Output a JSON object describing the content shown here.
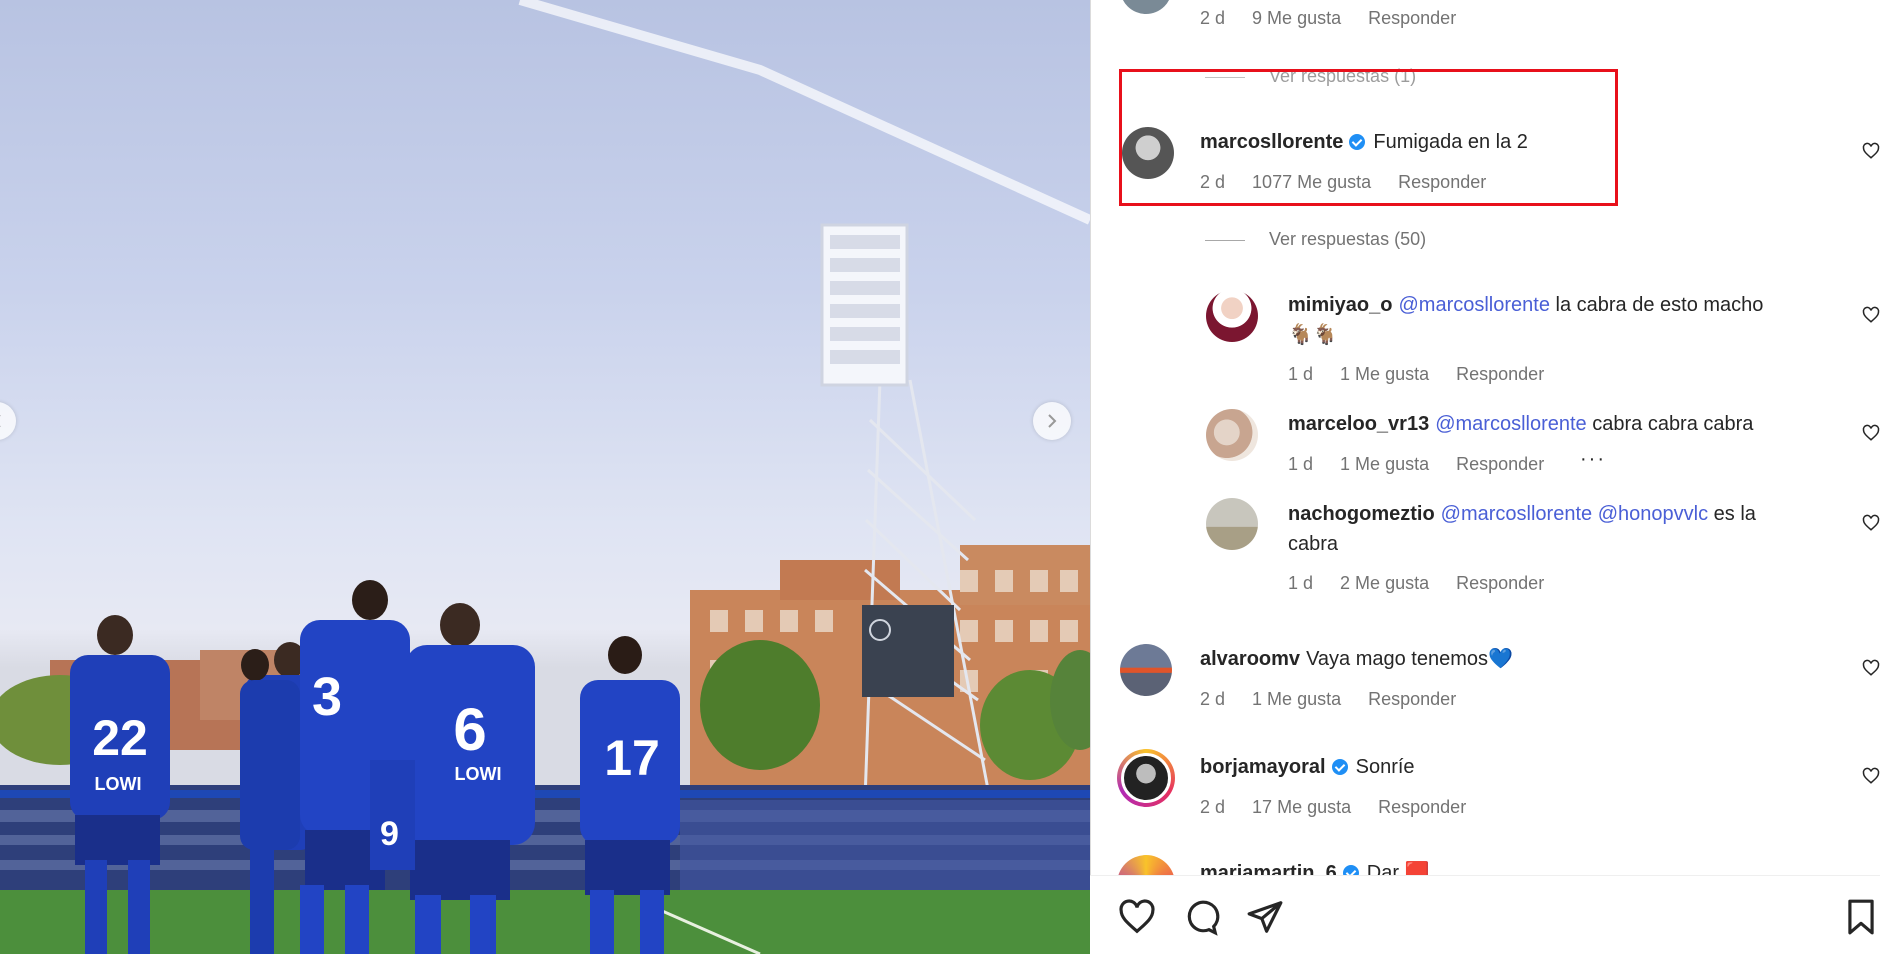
{
  "post_nav": {
    "next_icon": "chevron-right-icon",
    "prev_icon": "chevron-left-icon"
  },
  "colors": {
    "highlight": "#e8101b",
    "mention": "#4a5fd6",
    "verified": "#1f8ff5",
    "kit_blue": "#1f3fb8"
  },
  "top_comment": {
    "time": "2 d",
    "likes": "9 Me gusta",
    "reply": "Responder",
    "replies_toggle": "Ver respuestas (1)"
  },
  "comments": [
    {
      "username": "marcosllorente",
      "verified": true,
      "text": "Fumigada en la 2",
      "time": "2 d",
      "likes": "1077 Me gusta",
      "reply": "Responder",
      "replies_toggle": "Ver respuestas (50)",
      "replies": [
        {
          "username": "mimiyao_o",
          "mention": "@marcosllorente",
          "text": " la cabra de esto macho",
          "emoji": "🐐🐐",
          "time": "1 d",
          "likes": "1 Me gusta",
          "reply": "Responder"
        },
        {
          "username": "marceloo_vr13",
          "mention": "@marcosllorente",
          "text": " cabra cabra cabra",
          "time": "1 d",
          "likes": "1 Me gusta",
          "reply": "Responder",
          "more": "···"
        },
        {
          "username": "nachogomeztio",
          "mention": "@marcosllorente",
          "mention2": "@honopvvlc",
          "text": " es la",
          "text2": "cabra",
          "time": "1 d",
          "likes": "2 Me gusta",
          "reply": "Responder"
        }
      ]
    },
    {
      "username": "alvaroomv",
      "verified": false,
      "text": "Vaya mago tenemos",
      "emoji": "💙",
      "time": "2 d",
      "likes": "1 Me gusta",
      "reply": "Responder"
    },
    {
      "username": "borjamayoral",
      "verified": true,
      "text": "Sonríe",
      "time": "2 d",
      "likes": "17 Me gusta",
      "reply": "Responder"
    },
    {
      "username": "mariamartin_6",
      "verified": true,
      "text": "Dar",
      "emoji": "🟥"
    }
  ],
  "actions": {
    "like_icon": "heart-icon",
    "comment_icon": "comment-icon",
    "share_icon": "share-icon",
    "save_icon": "bookmark-icon"
  },
  "photo": {
    "jersey_numbers": [
      "22",
      "3",
      "6",
      "9",
      "17",
      "3"
    ],
    "sponsor": "LOWI"
  }
}
